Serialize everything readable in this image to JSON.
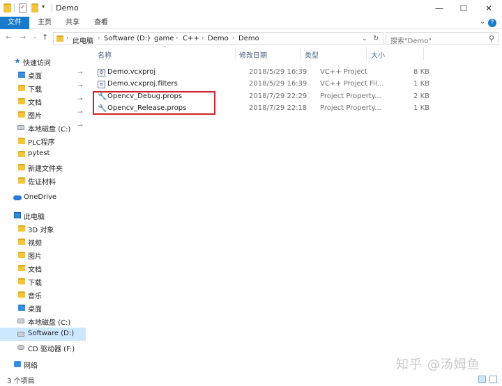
{
  "window": {
    "title": "Demo",
    "controls": {
      "minimize": "—",
      "maximize": "☐",
      "close": "✕"
    }
  },
  "ribbon": {
    "file_tab": "文件",
    "tabs": [
      "主页",
      "共享",
      "查看"
    ],
    "collapse_glyph": "⌄",
    "help_glyph": "?"
  },
  "address_bar": {
    "back": "←",
    "forward": "→",
    "dropdown": "⌄",
    "up": "↑",
    "breadcrumbs": [
      "此电脑",
      "Software (D:)",
      "game",
      "C++",
      "Demo",
      "Demo"
    ],
    "separator": "›",
    "refresh": "↻",
    "search_placeholder": "搜索\"Demo\""
  },
  "nav_pane": {
    "quick_access": "快速访问",
    "quick_items": [
      {
        "label": "桌面",
        "pinned": true
      },
      {
        "label": "下载",
        "pinned": true
      },
      {
        "label": "文档",
        "pinned": true
      },
      {
        "label": "图片",
        "pinned": true
      },
      {
        "label": "本地磁盘 (C:)",
        "pinned": true
      },
      {
        "label": "PLC程序",
        "pinned": false
      },
      {
        "label": "pytest",
        "pinned": false
      },
      {
        "label": "新建文件夹",
        "pinned": false
      },
      {
        "label": "佐证材料",
        "pinned": false
      }
    ],
    "onedrive": "OneDrive",
    "this_pc": "此电脑",
    "pc_items": [
      "3D 对象",
      "视频",
      "图片",
      "文档",
      "下载",
      "音乐",
      "桌面",
      "本地磁盘 (C:)",
      "Software (D:)",
      "CD 驱动器 (F:)"
    ],
    "selected": "Software (D:)",
    "network": "网络",
    "pin_glyph": "📌"
  },
  "columns": {
    "name": "名称",
    "date": "修改日期",
    "type": "类型",
    "size": "大小",
    "sort_glyph": "⌃"
  },
  "files": [
    {
      "name": "Demo.vcxproj",
      "date": "2018/5/29 16:39",
      "type": "VC++ Project",
      "size": "8 KB",
      "icon": "vcxproj-icon"
    },
    {
      "name": "Demo.vcxproj.filters",
      "date": "2018/5/29 16:39",
      "type": "VC++ Project Fil...",
      "size": "1 KB",
      "icon": "filters-icon"
    },
    {
      "name": "Opencv_Debug.props",
      "date": "2018/7/29 22:29",
      "type": "Project Property...",
      "size": "2 KB",
      "icon": "wrench-icon"
    },
    {
      "name": "Opencv_Release.props",
      "date": "2018/7/29 22:18",
      "type": "Project Property...",
      "size": "1 KB",
      "icon": "wrench-icon"
    }
  ],
  "status": {
    "item_count": "3 个项目"
  },
  "watermark": "知乎 @汤姆鱼",
  "colors": {
    "accent": "#1979ca",
    "selection": "#cce8ff",
    "highlight_box": "#d2202a"
  }
}
